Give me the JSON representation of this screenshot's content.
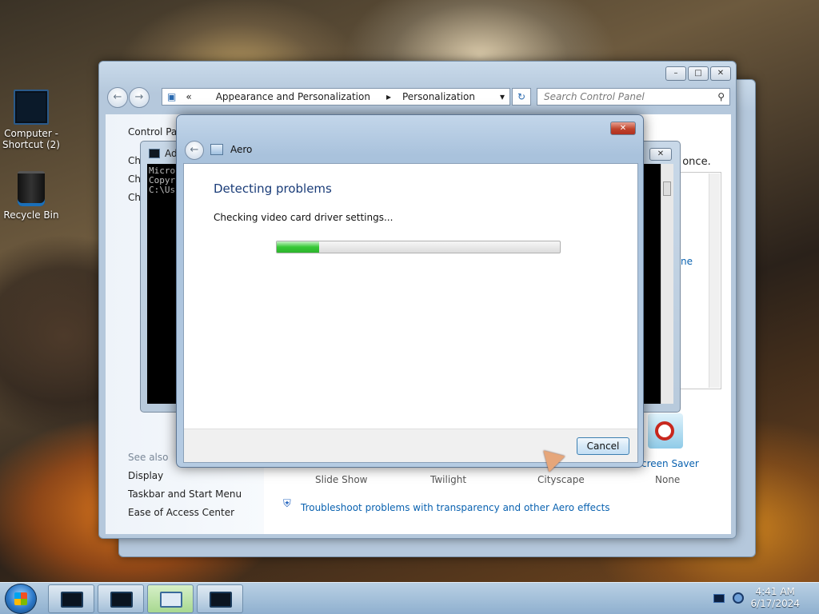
{
  "desktop": {
    "icons": [
      {
        "label": "Computer - Shortcut (2)"
      },
      {
        "label": "Recycle Bin"
      }
    ]
  },
  "control_panel": {
    "breadcrumb": {
      "prefix": "«",
      "items": [
        "Appearance and Personalization",
        "Personalization"
      ]
    },
    "search_placeholder": "Search Control Panel",
    "left_title": "Control Par",
    "left_ch": [
      "Ch",
      "Ch",
      "Ch"
    ],
    "see_also_heading": "See also",
    "see_also_links": [
      "Display",
      "Taskbar and Start Menu",
      "Ease of Access Center"
    ],
    "themes": [
      "Slide Show",
      "Twilight",
      "Cityscape",
      "None"
    ],
    "screen_saver_label": "creen Saver",
    "partial_text_right": "t once.",
    "partial_link_right": "ne",
    "troubleshoot_link": "Troubleshoot problems with transparency and other Aero effects"
  },
  "cmd": {
    "title_fragment": "Ad",
    "lines": [
      "Micro",
      "Copyr",
      "",
      "C:\\Us"
    ]
  },
  "aero_dialog": {
    "title": "Aero",
    "heading": "Detecting problems",
    "status": "Checking video card driver settings...",
    "progress_fraction": 0.15,
    "cancel_label": "Cancel"
  },
  "taskbar": {
    "clock_time": "4:41 AM",
    "clock_date": "6/17/2024"
  }
}
